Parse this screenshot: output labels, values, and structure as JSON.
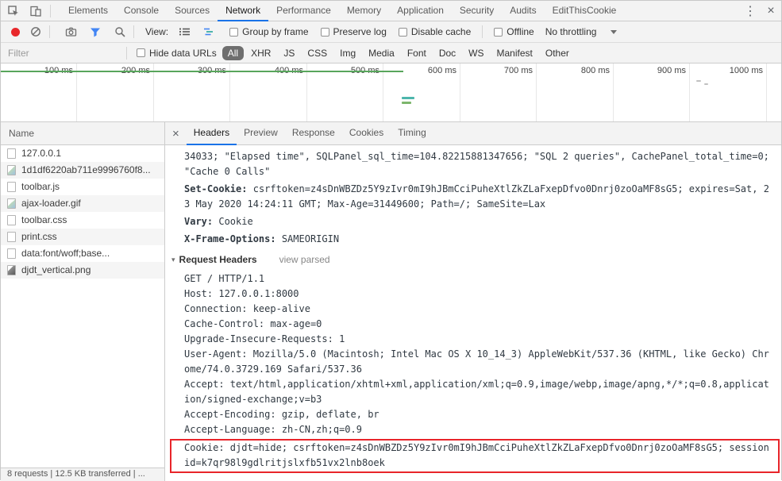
{
  "window": {
    "menu_icon": "⋮",
    "close_icon": "×"
  },
  "devtools": {
    "tabs": [
      "Elements",
      "Console",
      "Sources",
      "Network",
      "Performance",
      "Memory",
      "Application",
      "Security",
      "Audits",
      "EditThisCookie"
    ],
    "active_tab": "Network"
  },
  "toolbar": {
    "view_label": "View:",
    "checkboxes": [
      "Group by frame",
      "Preserve log",
      "Disable cache",
      "Offline"
    ],
    "throttling": "No throttling"
  },
  "filter_row": {
    "placeholder": "Filter",
    "hide_data_urls": "Hide data URLs",
    "pills": [
      "All",
      "XHR",
      "JS",
      "CSS",
      "Img",
      "Media",
      "Font",
      "Doc",
      "WS",
      "Manifest",
      "Other"
    ],
    "active_pill": "All"
  },
  "timeline": {
    "ticks": [
      "100 ms",
      "200 ms",
      "300 ms",
      "400 ms",
      "500 ms",
      "600 ms",
      "700 ms",
      "800 ms",
      "900 ms",
      "1000 ms"
    ]
  },
  "requests": {
    "column_header": "Name",
    "rows": [
      {
        "name": "127.0.0.1",
        "icon": "document-icon"
      },
      {
        "name": "1d1df6220ab711e9996760f8...",
        "icon": "image-icon"
      },
      {
        "name": "toolbar.js",
        "icon": "script-icon"
      },
      {
        "name": "ajax-loader.gif",
        "icon": "image-icon"
      },
      {
        "name": "toolbar.css",
        "icon": "stylesheet-icon"
      },
      {
        "name": "print.css",
        "icon": "stylesheet-icon"
      },
      {
        "name": "data:font/woff;base...",
        "icon": "font-icon"
      },
      {
        "name": "djdt_vertical.png",
        "icon": "image-icon"
      }
    ]
  },
  "details": {
    "close_icon": "×",
    "tabs": [
      "Headers",
      "Preview",
      "Response",
      "Cookies",
      "Timing"
    ],
    "active_tab": "Headers",
    "overflow": "34033; \"Elapsed time\", SQLPanel_sql_time=104.82215881347656; \"SQL 2 queries\", CachePanel_total_time=0; \"Cache 0 Calls\"",
    "response_headers": [
      {
        "key": "Set-Cookie:",
        "value": "csrftoken=z4sDnWBZDz5Y9zIvr0mI9hJBmCciPuheXtlZkZLaFxepDfvo0Dnrj0zoOaMF8sG5; expires=Sat, 23 May 2020 14:24:11 GMT; Max-Age=31449600; Path=/; SameSite=Lax"
      },
      {
        "key": "Vary:",
        "value": "Cookie"
      },
      {
        "key": "X-Frame-Options:",
        "value": "SAMEORIGIN"
      }
    ],
    "request_section": {
      "label": "Request Headers",
      "link": "view parsed"
    },
    "raw": [
      "GET / HTTP/1.1",
      "Host: 127.0.0.1:8000",
      "Connection: keep-alive",
      "Cache-Control: max-age=0",
      "Upgrade-Insecure-Requests: 1",
      "User-Agent: Mozilla/5.0 (Macintosh; Intel Mac OS X 10_14_3) AppleWebKit/537.36 (KHTML, like Gecko) Chrome/74.0.3729.169 Safari/537.36",
      "Accept: text/html,application/xhtml+xml,application/xml;q=0.9,image/webp,image/apng,*/*;q=0.8,application/signed-exchange;v=b3",
      "Accept-Encoding: gzip, deflate, br",
      "Accept-Language: zh-CN,zh;q=0.9"
    ],
    "cookie": "Cookie: djdt=hide; csrftoken=z4sDnWBZDz5Y9zIvr0mI9hJBmCciPuheXtlZkZLaFxepDfvo0Dnrj0zoOaMF8sG5; sessionid=k7qr98l9gdlritjslxfb51vx2lnb8oek"
  },
  "status_bar": {
    "text": "8 requests | 12.5 KB transferred | ..."
  },
  "colors": {
    "accent_blue": "#1a73e8",
    "record_red": "#e8282b",
    "pill_active_bg": "#6e6e6e",
    "highlight_red": "#e8252a",
    "timeline_green": "#58a65c"
  }
}
